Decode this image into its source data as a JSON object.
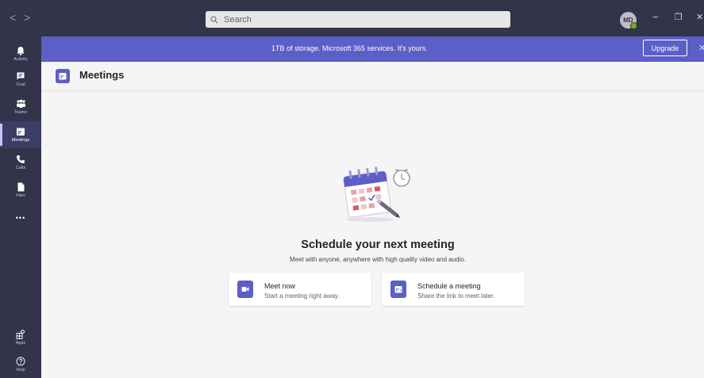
{
  "titlebar": {
    "back": "<",
    "forward": ">",
    "search_placeholder": "Search",
    "avatar_initials": "MD",
    "minimize": "−",
    "restore": "❐",
    "close": "✕"
  },
  "rail": {
    "items": [
      {
        "label": "Activity",
        "icon": "bell-icon"
      },
      {
        "label": "Chat",
        "icon": "chat-icon"
      },
      {
        "label": "Teams",
        "icon": "teams-icon"
      },
      {
        "label": "Meetings",
        "icon": "calendar-icon",
        "active": true
      },
      {
        "label": "Calls",
        "icon": "phone-icon"
      },
      {
        "label": "Files",
        "icon": "file-icon"
      }
    ],
    "more": "•••",
    "apps_label": "Apps",
    "help_label": "Help"
  },
  "banner": {
    "text": "1TB of storage. Microsoft 365 services. It's yours.",
    "button": "Upgrade",
    "close": "✕"
  },
  "header": {
    "title": "Meetings"
  },
  "main": {
    "headline": "Schedule your next meeting",
    "subline": "Meet with anyone, anywhere with high quality video and audio.",
    "cards": [
      {
        "title": "Meet now",
        "subtitle": "Start a meeting right away.",
        "icon": "video-icon"
      },
      {
        "title": "Schedule a meeting",
        "subtitle": "Share the link to meet later.",
        "icon": "calendar-add-icon"
      }
    ]
  },
  "colors": {
    "rail": "#33344a",
    "accent": "#5b5fc7",
    "background": "#f5f5f5"
  }
}
